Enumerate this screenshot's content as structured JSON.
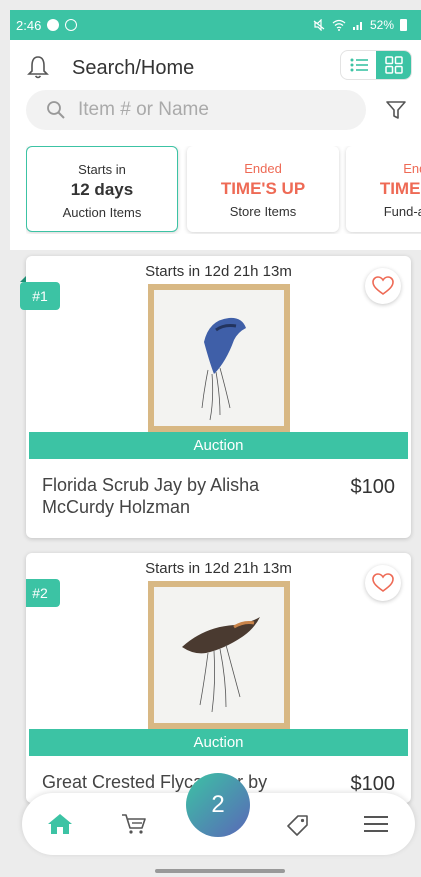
{
  "status_bar": {
    "time": "2:46",
    "battery": "52%"
  },
  "header": {
    "title": "Search/Home"
  },
  "search": {
    "placeholder": "Item # or Name"
  },
  "tiles": [
    {
      "top": "Starts in",
      "main": "12 days",
      "sub": "Auction Items"
    },
    {
      "top": "Ended",
      "main": "TIME'S UP",
      "sub": "Store Items"
    },
    {
      "top": "Ended",
      "main": "TIME'S UP",
      "sub": "Fund-a-Need"
    }
  ],
  "items": [
    {
      "starts": "Starts in 12d 21h 13m",
      "lot": "#1",
      "badge": "Auction",
      "name": "Florida Scrub Jay by Alisha McCurdy Holzman",
      "price": "$100"
    },
    {
      "starts": "Starts in 12d 21h 13m",
      "lot": "#2",
      "badge": "Auction",
      "name": "Great Crested Flycatcher by",
      "price": "$100"
    }
  ],
  "nav": {
    "cart_count": "2"
  },
  "colors": {
    "accent": "#3cc3a4",
    "ended": "#ee6a55",
    "heart": "#ee6a55"
  }
}
